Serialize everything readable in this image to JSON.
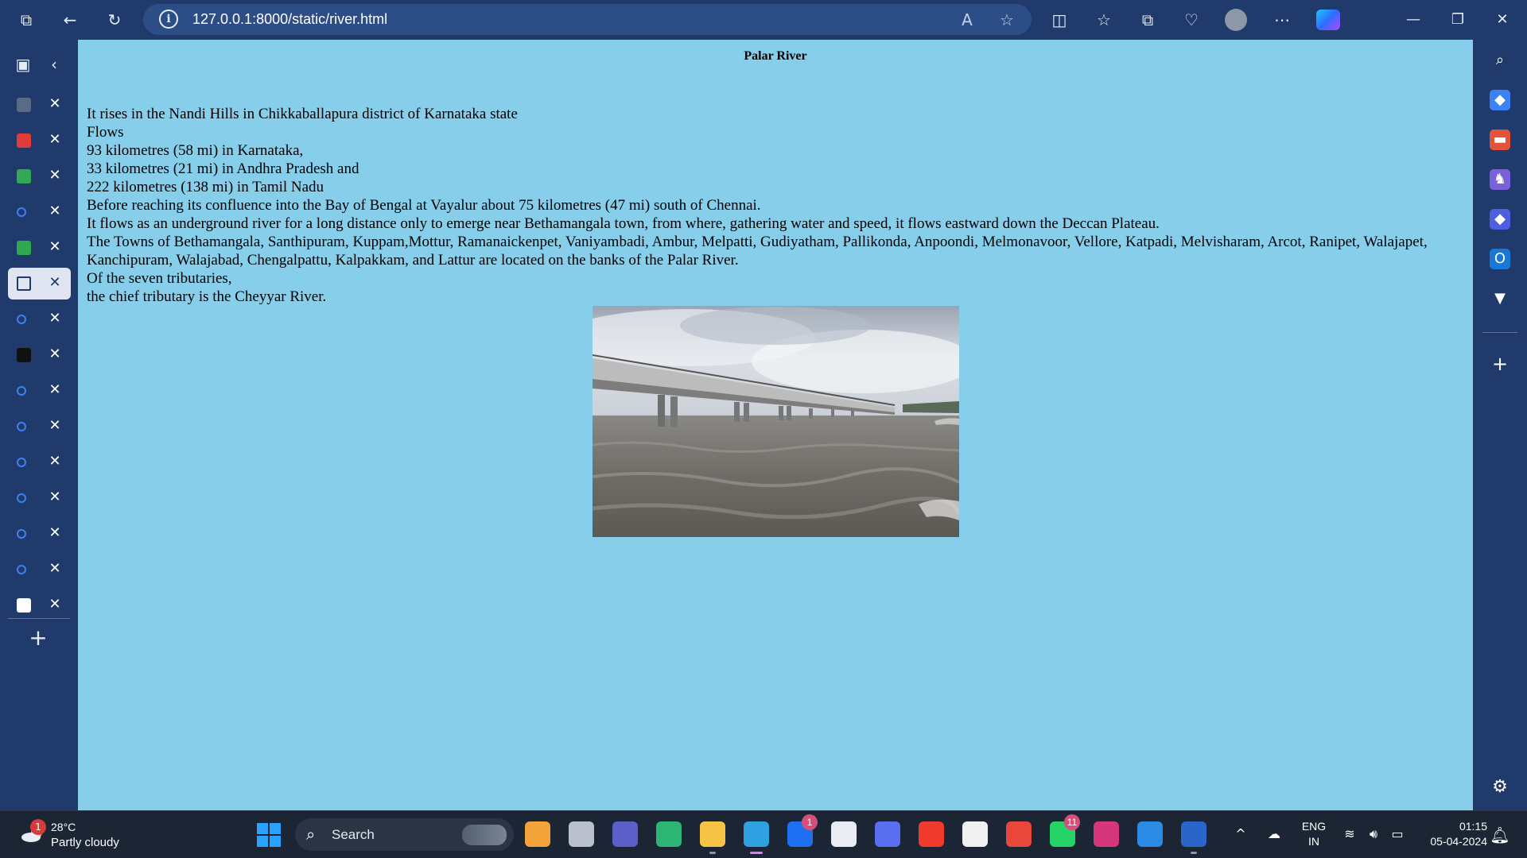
{
  "browser": {
    "url": "127.0.0.1:8000/static/river.html",
    "buttons": {
      "workspaces": "⧉",
      "back": "←",
      "refresh": "↻",
      "info": "i",
      "read_aloud": "A",
      "favorite": "☆",
      "split": "◫",
      "favorites": "☆",
      "collections": "⧉",
      "performance": "♡",
      "more": "⋯",
      "minimize": "—",
      "restore": "❐",
      "close": "✕"
    }
  },
  "vertical_tabs": {
    "toggle_icon": "▣",
    "collapse_icon": "‹",
    "close_glyph": "✕",
    "new_tab_glyph": "+",
    "tabs": [
      {
        "icon": "linkedin-icon",
        "color": "#5b6b85",
        "active": false
      },
      {
        "icon": "youtube-icon",
        "color": "#e23b3b",
        "active": false
      },
      {
        "icon": "maps-pin-icon",
        "color": "#34a853",
        "active": false
      },
      {
        "icon": "search-icon",
        "color": "#3c82f0",
        "active": false
      },
      {
        "icon": "sheets-icon",
        "color": "#2fa84f",
        "active": false
      },
      {
        "icon": "document-icon",
        "color": "#1f3a6b",
        "active": true
      },
      {
        "icon": "search-icon",
        "color": "#3c82f0",
        "active": false
      },
      {
        "icon": "dotted-circle-icon",
        "color": "#111111",
        "active": false
      },
      {
        "icon": "search-icon",
        "color": "#3c82f0",
        "active": false
      },
      {
        "icon": "search-icon",
        "color": "#3c82f0",
        "active": false
      },
      {
        "icon": "search-icon",
        "color": "#3c82f0",
        "active": false
      },
      {
        "icon": "search-icon",
        "color": "#3c82f0",
        "active": false
      },
      {
        "icon": "search-icon",
        "color": "#3c82f0",
        "active": false
      },
      {
        "icon": "search-icon",
        "color": "#3c82f0",
        "active": false
      },
      {
        "icon": "wikipedia-icon",
        "color": "#ffffff",
        "active": false
      }
    ]
  },
  "right_sidebar": {
    "icons": [
      {
        "name": "search-icon",
        "glyph": "⌕",
        "color": "#1f3a6b"
      },
      {
        "name": "shopping-tag-icon",
        "glyph": "◆",
        "color": "#3b82f6"
      },
      {
        "name": "tools-icon",
        "glyph": "▬",
        "color": "#e2533b"
      },
      {
        "name": "games-icon",
        "glyph": "♞",
        "color": "#7b61d9"
      },
      {
        "name": "copilot-app-icon",
        "glyph": "◆",
        "color": "#4b5fe0"
      },
      {
        "name": "outlook-icon",
        "glyph": "O",
        "color": "#1778d6"
      },
      {
        "name": "drop-icon",
        "glyph": "▼",
        "color": "#1f3a6b"
      }
    ],
    "add_glyph": "+",
    "settings_glyph": "⚙"
  },
  "page": {
    "title": "Palar River",
    "lines": [
      "It rises in the Nandi Hills in Chikkaballapura district of Karnataka state",
      "Flows",
      "93 kilometres (58 mi) in Karnataka,",
      "33 kilometres (21 mi) in Andhra Pradesh and",
      "222 kilometres (138 mi) in Tamil Nadu",
      "Before reaching its confluence into the Bay of Bengal at Vayalur about 75 kilometres (47 mi) south of Chennai.",
      "It flows as an underground river for a long distance only to emerge near Bethamangala town, from where, gathering water and speed, it flows eastward down the Deccan Plateau.",
      "The Towns of Bethamangala, Santhipuram, Kuppam,Mottur, Ramanaickenpet, Vaniyambadi, Ambur, Melpatti, Gudiyatham, Pallikonda, Anpoondi, Melmonavoor, Vellore, Katpadi, Melvisharam, Arcot, Ranipet, Walajapet, Kanchipuram, Walajabad, Chengalpattu, Kalpakkam, and Lattur are located on the banks of the Palar River.",
      "Of the seven tributaries,",
      "the chief tributary is the Cheyyar River."
    ]
  },
  "taskbar": {
    "weather": {
      "temp": "28°C",
      "condition": "Partly cloudy",
      "badge": "1"
    },
    "search_label": "Search",
    "apps": [
      {
        "name": "copilot-preview-icon",
        "color": "#f2a33a",
        "badge": ""
      },
      {
        "name": "file-stack-icon",
        "color": "#b9c0cc",
        "badge": ""
      },
      {
        "name": "teams-icon",
        "color": "#5b5fc7",
        "badge": ""
      },
      {
        "name": "refresh-app-icon",
        "color": "#2bb673",
        "badge": ""
      },
      {
        "name": "file-explorer-icon",
        "color": "#f6c445",
        "badge": ""
      },
      {
        "name": "edge-icon",
        "color": "#2fa0e0",
        "badge": ""
      },
      {
        "name": "l-app-icon",
        "color": "#1e6ff2",
        "badge": "1"
      },
      {
        "name": "store-icon",
        "color": "#e9edf3",
        "badge": ""
      },
      {
        "name": "arc-icon",
        "color": "#5a6ef0",
        "badge": ""
      },
      {
        "name": "youtube-icon",
        "color": "#f03a2e",
        "badge": ""
      },
      {
        "name": "notes-icon",
        "color": "#f0f0f0",
        "badge": ""
      },
      {
        "name": "chrome-icon",
        "color": "#e8473a",
        "badge": ""
      },
      {
        "name": "whatsapp-icon",
        "color": "#25d366",
        "badge": "11"
      },
      {
        "name": "instagram-icon",
        "color": "#d6367a",
        "badge": ""
      },
      {
        "name": "vscode-icon",
        "color": "#2b8ae6",
        "badge": ""
      },
      {
        "name": "word-icon",
        "color": "#2b65c9",
        "badge": ""
      }
    ],
    "tray_chevron": "^",
    "lang": {
      "line1": "ENG",
      "line2": "IN"
    },
    "clock": {
      "time": "01:15",
      "date": "05-04-2024"
    }
  }
}
